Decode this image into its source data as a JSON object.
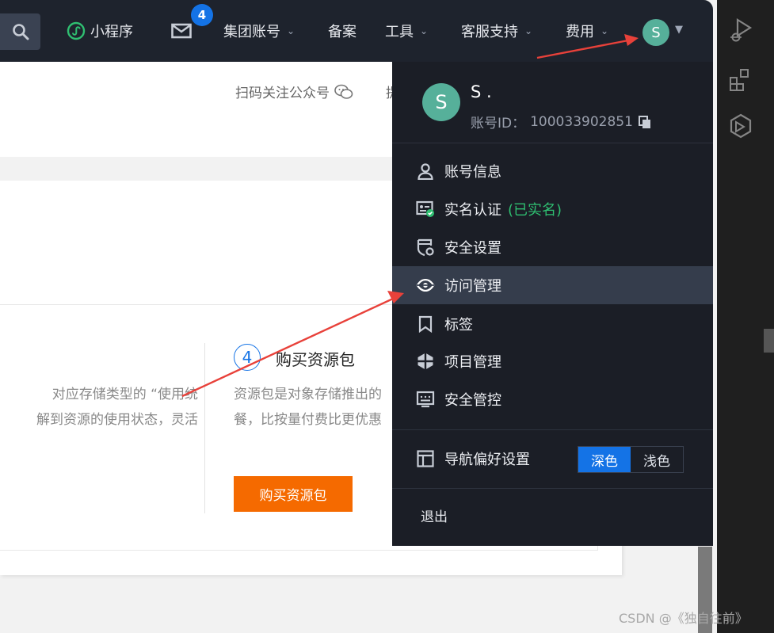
{
  "topnav": {
    "mini_program": "小程序",
    "messages_badge": "4",
    "group_account": "集团账号",
    "filing": "备案",
    "tools": "工具",
    "support": "客服支持",
    "billing": "费用",
    "avatar_letter": "S"
  },
  "content": {
    "wechat_follow": "扫码关注公众号",
    "header_cut": "提",
    "left_text_line1": "对应存储类型的 “使用统",
    "left_text_line2": "解到资源的使用状态，灵活",
    "step_number": "4",
    "step_title": "购买资源包",
    "step_desc_line1": "资源包是对象存储推出的",
    "step_desc_line2": "餐，比按量付费比更优惠",
    "buy_button": "购买资源包"
  },
  "dropdown": {
    "avatar_letter": "S",
    "user_name": "S .",
    "account_id_label": "账号ID：",
    "account_id": "100033902851",
    "items": [
      {
        "label": "账号信息"
      },
      {
        "label": "实名认证",
        "status": "(已实名)"
      },
      {
        "label": "安全设置"
      },
      {
        "label": "访问管理"
      },
      {
        "label": "标签"
      },
      {
        "label": "项目管理"
      },
      {
        "label": "安全管控"
      }
    ],
    "nav_pref_label": "导航偏好设置",
    "theme_dark": "深色",
    "theme_light": "浅色",
    "logout": "退出"
  },
  "colors": {
    "nav_bg": "#1e232d",
    "dropdown_bg": "#1b1e26",
    "accent_blue": "#1473e6",
    "orange": "#f56a00",
    "verified_green": "#2fbf71",
    "annotation_red": "#e8413a"
  },
  "watermark": "CSDN @《独自往前》"
}
